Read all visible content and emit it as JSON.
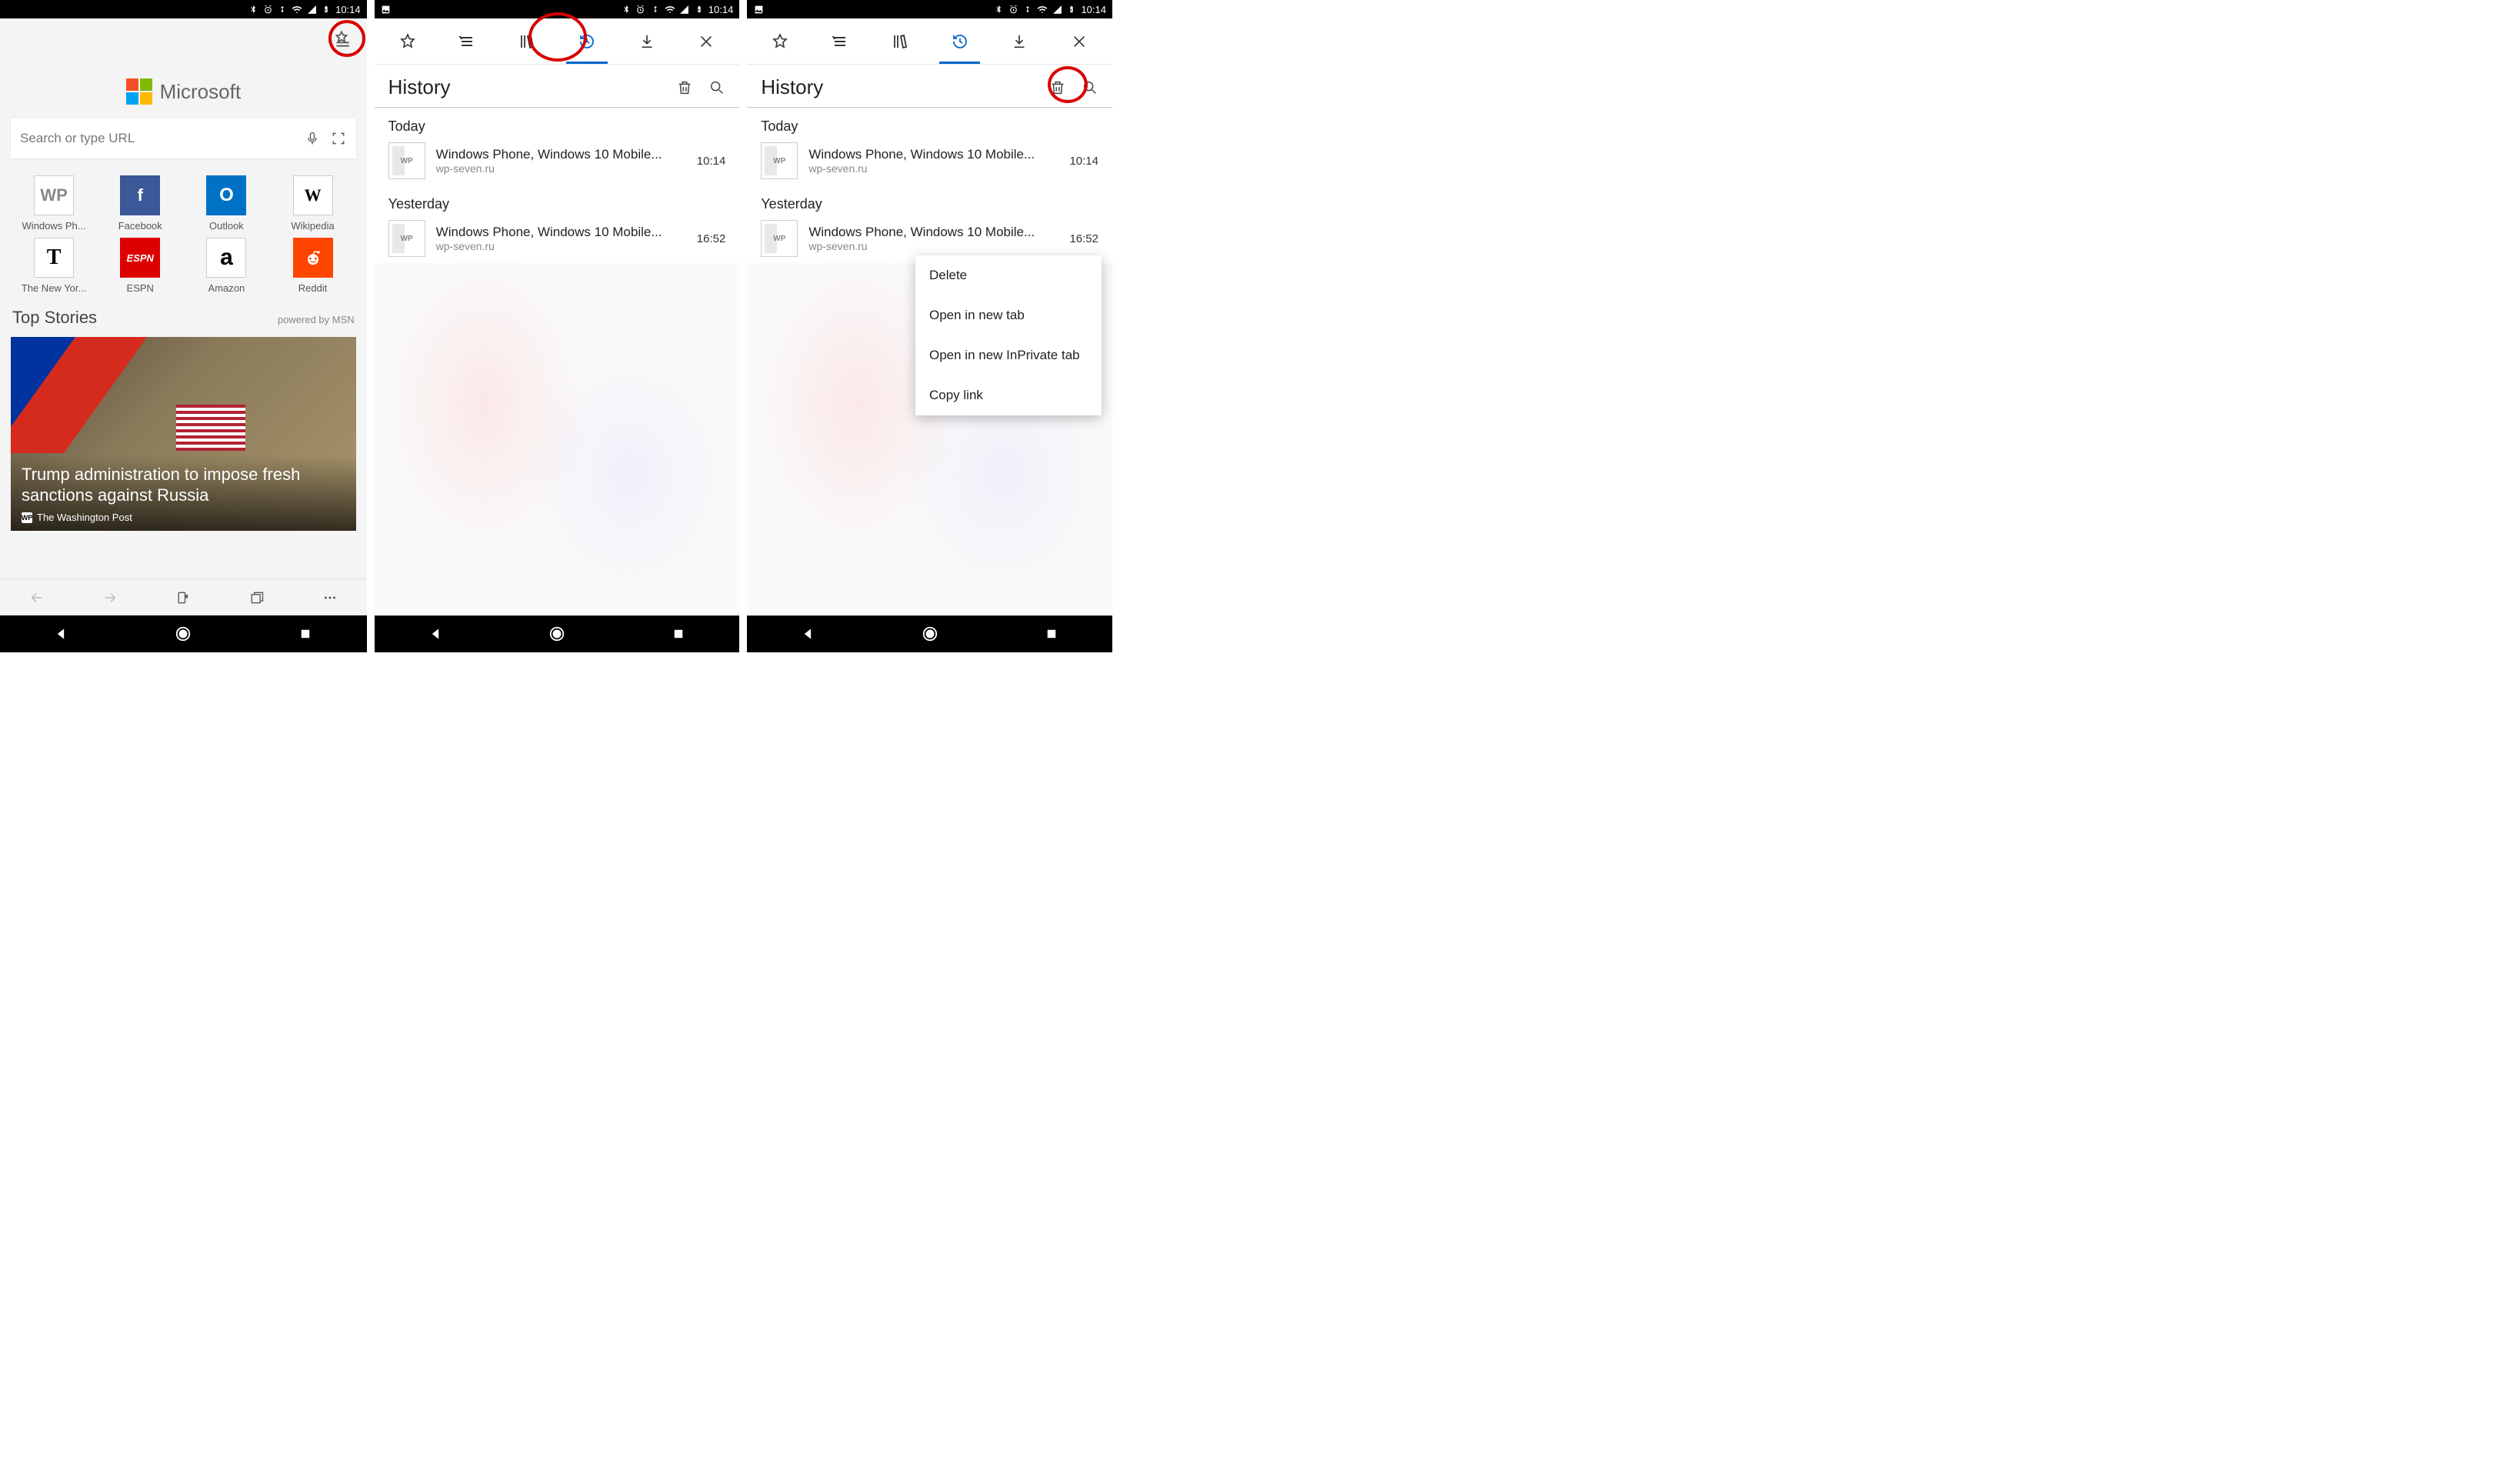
{
  "statusbar": {
    "time": "10:14"
  },
  "panel1": {
    "brand": "Microsoft",
    "search_placeholder": "Search or type URL",
    "tiles": [
      {
        "label": "Windows Ph...",
        "short": "WP"
      },
      {
        "label": "Facebook",
        "short": "f"
      },
      {
        "label": "Outlook",
        "short": "O"
      },
      {
        "label": "Wikipedia",
        "short": "W"
      },
      {
        "label": "The New Yor...",
        "short": "T"
      },
      {
        "label": "ESPN",
        "short": "ESPN"
      },
      {
        "label": "Amazon",
        "short": "a"
      },
      {
        "label": "Reddit",
        "short": "r"
      }
    ],
    "top_stories_label": "Top Stories",
    "powered_label": "powered by MSN",
    "story": {
      "headline": "Trump administration to impose fresh sanctions against Russia",
      "source": "The Washington Post",
      "source_short": "WP"
    }
  },
  "hub": {
    "tabs": [
      {
        "id": "favorites",
        "icon": "star"
      },
      {
        "id": "reading-list",
        "icon": "reading-list"
      },
      {
        "id": "books",
        "icon": "books"
      },
      {
        "id": "history",
        "icon": "history",
        "active": true
      },
      {
        "id": "downloads",
        "icon": "download"
      },
      {
        "id": "close",
        "icon": "close"
      }
    ],
    "history_title": "History",
    "sections": [
      {
        "label": "Today",
        "items": [
          {
            "title": "Windows Phone, Windows 10 Mobile...",
            "url": "wp-seven.ru",
            "time": "10:14"
          }
        ]
      },
      {
        "label": "Yesterday",
        "items": [
          {
            "title": "Windows Phone, Windows 10 Mobile...",
            "url": "wp-seven.ru",
            "time": "16:52"
          }
        ]
      }
    ]
  },
  "context_menu": {
    "items": [
      "Delete",
      "Open in new tab",
      "Open in new InPrivate tab",
      "Copy link"
    ]
  },
  "tile_colors": {
    "Windows Ph...": "#ffffff",
    "Facebook": "#3b5998",
    "Outlook": "#0072c6",
    "Wikipedia": "#ffffff",
    "The New Yor...": "#ffffff",
    "ESPN": "#d00",
    "Amazon": "#ffffff",
    "Reddit": "#ff4500"
  }
}
